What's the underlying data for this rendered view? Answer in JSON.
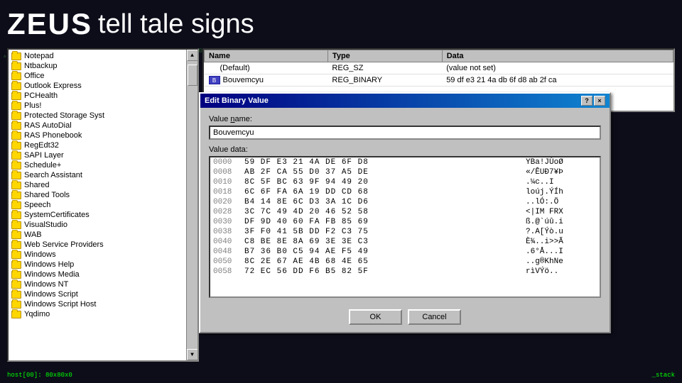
{
  "title": {
    "zeus": "ZEUS",
    "rest": "tell tale signs"
  },
  "registry": {
    "items": [
      "Notepad",
      "Ntbackup",
      "Office",
      "Outlook Express",
      "PCHealth",
      "Plus!",
      "Protected Storage Syst",
      "RAS AutoDial",
      "RAS Phonebook",
      "RegEdt32",
      "SAPI Layer",
      "Schedule+",
      "Search Assistant",
      "Shared",
      "Shared Tools",
      "Speech",
      "SystemCertificates",
      "VisualStudio",
      "WAB",
      "Web Service Providers",
      "Windows",
      "Windows Help",
      "Windows Media",
      "Windows NT",
      "Windows Script",
      "Windows Script Host",
      "Yqdimo"
    ]
  },
  "values": {
    "columns": [
      "Name",
      "Type",
      "Data"
    ],
    "rows": [
      [
        "(Default)",
        "REG_SZ",
        "(value not set)"
      ],
      [
        "Bouvemcyu",
        "REG_BINARY",
        "59 df e3 21 4a db 6f d8 ab 2f ca"
      ]
    ]
  },
  "dialog": {
    "title": "Edit Binary Value",
    "value_name_label": "Value name:",
    "value_name": "Bouvemcyu",
    "value_data_label": "Value data:",
    "hex_rows": [
      {
        "offset": "0000",
        "bytes": "59 DF E3 21 4A DE 6F D8",
        "ascii": "YBa!JÙoØ"
      },
      {
        "offset": "0008",
        "bytes": "AB 2F CA 55 D0 37 A5 DE",
        "ascii": "«/ÊUÐ7¥Þ"
      },
      {
        "offset": "0010",
        "bytes": "8C 5F BC 63 9F 94 49 20",
        "ascii": ".¼c..I "
      },
      {
        "offset": "0018",
        "bytes": "6C 6F FA 6A 19 DD CD 68",
        "ascii": "loúj.ÝÍh"
      },
      {
        "offset": "0020",
        "bytes": "B4 14 8E 6C D3 3A 1C D6",
        "ascii": "..lÓ:.Ö"
      },
      {
        "offset": "0028",
        "bytes": "3C 7C 49 4D 20 46 52 58",
        "ascii": "<|IM FRX"
      },
      {
        "offset": "0030",
        "bytes": "DF 9D 40 60 FA FB 85 69",
        "ascii": "ß.@`úû.i"
      },
      {
        "offset": "0038",
        "bytes": "3F F0 41 5B DD F2 C3 75",
        "ascii": "?.A[Ýò.u"
      },
      {
        "offset": "0040",
        "bytes": "C8 BE 8E 8A 69 3E 3E C3",
        "ascii": "È¾..i>>Ã"
      },
      {
        "offset": "0048",
        "bytes": "B7 36 B0 C5 94 AE F5 49",
        "ascii": ".6°Å...I"
      },
      {
        "offset": "0050",
        "bytes": "8C 2E 67 AE 4B 68 4E 65",
        "ascii": "..g®KhNe"
      },
      {
        "offset": "0058",
        "bytes": "72 EC 56 DD F6 B5 82 5F",
        "ascii": "rìVÝö.."
      }
    ],
    "ok": "OK",
    "cancel": "Cancel",
    "help_btn": "?",
    "close_btn": "×"
  },
  "status": {
    "left": "host[00]:  80x80x0",
    "right": "_stack"
  }
}
